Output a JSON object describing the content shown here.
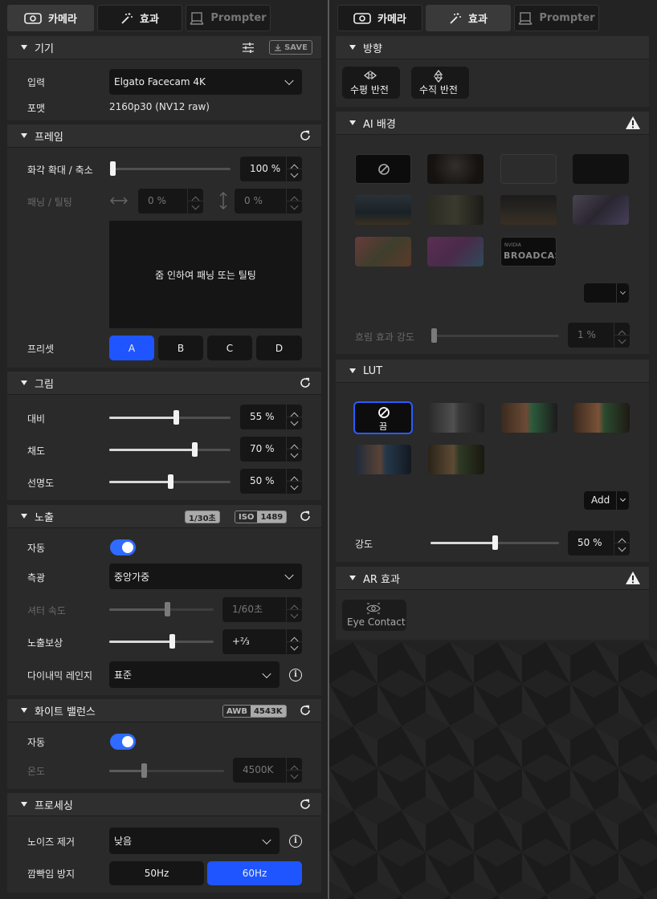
{
  "tabs_left": {
    "camera": "카메라",
    "effects": "효과",
    "prompter": "Prompter"
  },
  "tabs_right": {
    "camera": "카메라",
    "effects": "효과",
    "prompter": "Prompter"
  },
  "device": {
    "title": "기기",
    "save": "SAVE",
    "input_label": "입력",
    "input_value": "Elgato Facecam 4K",
    "format_label": "포맷",
    "format_value": "2160p30 (NV12 raw)"
  },
  "frame": {
    "title": "프레임",
    "zoom_label": "화각 확대 / 축소",
    "zoom_value": "100 %",
    "zoom_fraction": 0.0,
    "pantilt_label": "패닝 / 틸팅",
    "pan_value": "0 %",
    "tilt_value": "0 %",
    "preview_text": "줌 인하여 패닝 또는 틸팅",
    "preset_label": "프리셋",
    "presets": [
      "A",
      "B",
      "C",
      "D"
    ],
    "preset_selected": "A"
  },
  "picture": {
    "title": "그림",
    "contrast_label": "대비",
    "contrast_value": "55 %",
    "contrast_fraction": 0.55,
    "saturation_label": "채도",
    "saturation_value": "70 %",
    "saturation_fraction": 0.7,
    "sharpness_label": "선명도",
    "sharpness_value": "50 %",
    "sharpness_fraction": 0.5
  },
  "exposure": {
    "title": "노출",
    "shutter_badge": "1/30초",
    "iso_key": "ISO",
    "iso_value": "1489",
    "auto_label": "자동",
    "auto_on": true,
    "metering_label": "측광",
    "metering_value": "중앙가중",
    "shutter_label": "셔터 속도",
    "shutter_value": "1/60초",
    "shutter_fraction": 0.55,
    "comp_label": "노출보상",
    "comp_value": "+⅔",
    "comp_fraction": 0.6,
    "drange_label": "다이내믹 레인지",
    "drange_value": "표준"
  },
  "whitebalance": {
    "title": "화이트 밸런스",
    "awb_key": "AWB",
    "awb_value": "4543K",
    "auto_label": "자동",
    "auto_on": true,
    "temp_label": "온도",
    "temp_value": "4500K",
    "temp_fraction": 0.3
  },
  "processing": {
    "title": "프로세싱",
    "noise_label": "노이즈 제거",
    "noise_value": "낮음",
    "flicker_label": "깜빡임 방지",
    "flicker_options": [
      "50Hz",
      "60Hz"
    ],
    "flicker_selected": "60Hz"
  },
  "direction": {
    "title": "방향",
    "hflip": "수평 반전",
    "vflip": "수직 반전"
  },
  "ai_bg": {
    "title": "AI 배경",
    "broadcast_brand": "NVIDIA",
    "broadcast_text": "BROADCAST",
    "blur_label": "흐림 효과 강도",
    "blur_value": "1 %",
    "blur_fraction": 0.01
  },
  "lut": {
    "title": "LUT",
    "off_label": "끔",
    "add_label": "Add",
    "intensity_label": "강도",
    "intensity_value": "50 %",
    "intensity_fraction": 0.5
  },
  "ar": {
    "title": "AR 효과",
    "eye_contact": "Eye Contact"
  },
  "colors": {
    "accent": "#1f55ff",
    "panel": "#2a2a2a",
    "toggle": "#2f6bff"
  }
}
